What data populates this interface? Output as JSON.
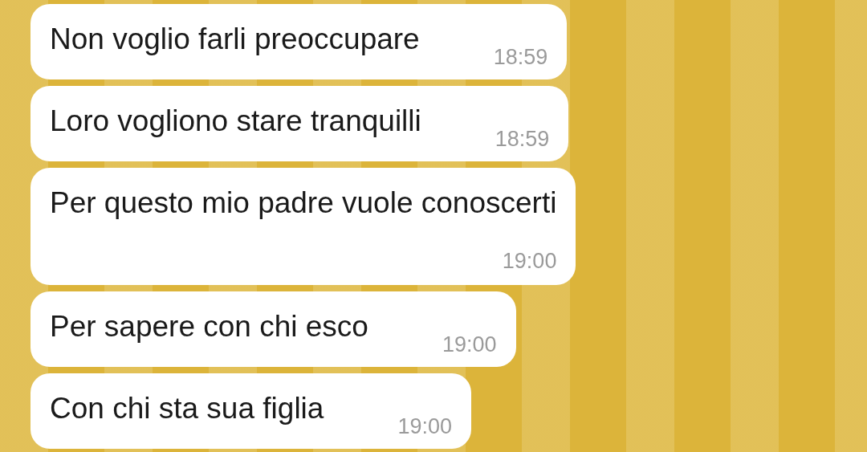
{
  "messages": [
    {
      "text": "Non voglio farli preoccupare",
      "time": "18:59",
      "kind": "inline"
    },
    {
      "text": "Loro vogliono stare tranquilli",
      "time": "18:59",
      "kind": "inline"
    },
    {
      "text": "Per questo mio padre vuole conoscerti",
      "time": "19:00",
      "kind": "stacked"
    },
    {
      "text": "Per sapere con chi esco",
      "time": "19:00",
      "kind": "inline"
    },
    {
      "text": "Con chi sta sua figlia",
      "time": "19:00",
      "kind": "inline"
    }
  ]
}
